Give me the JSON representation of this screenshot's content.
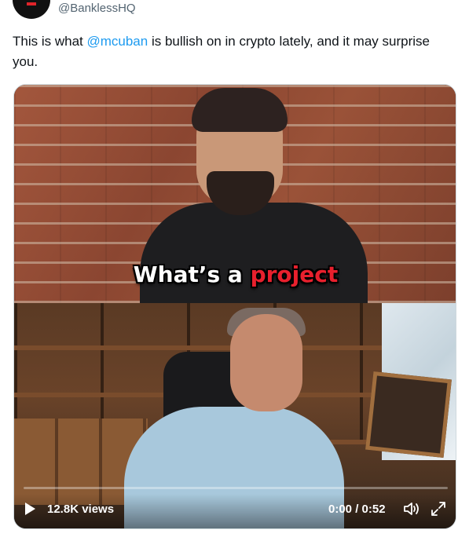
{
  "header": {
    "handle": "@BanklessHQ"
  },
  "tweet": {
    "text_before": "This is what ",
    "mention": "@mcuban",
    "text_after": " is bullish on in crypto lately, and it may surprise you."
  },
  "video": {
    "caption_white": "What’s a ",
    "caption_red": "project",
    "views": "12.8K views",
    "time": "0:00 / 0:52",
    "progress_fraction": 0.0,
    "accent_color": "#1d9bf0",
    "icons": [
      "play-icon",
      "volume-icon",
      "fullscreen-icon"
    ]
  }
}
